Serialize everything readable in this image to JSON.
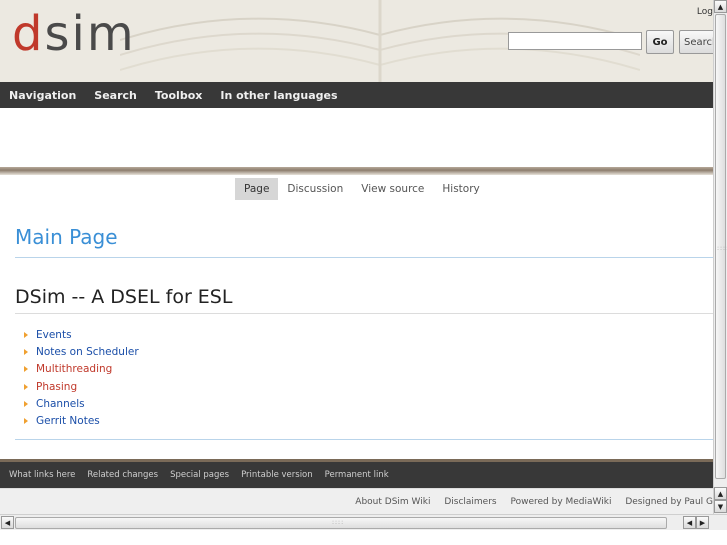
{
  "header": {
    "logo_prefix": "d",
    "logo_suffix": "sim",
    "login_link": "Log",
    "search": {
      "value": "",
      "placeholder": ""
    },
    "go_label": "Go",
    "search_label": "Search"
  },
  "nav": [
    "Navigation",
    "Search",
    "Toolbox",
    "In other languages"
  ],
  "tabs": [
    {
      "label": "Page",
      "active": true
    },
    {
      "label": "Discussion"
    },
    {
      "label": "View source"
    },
    {
      "label": "History"
    }
  ],
  "content": {
    "page_title": "Main Page",
    "section_title": "DSim -- A DSEL for ESL",
    "links": [
      {
        "label": "Events",
        "state": "blue"
      },
      {
        "label": "Notes on Scheduler",
        "state": "blue"
      },
      {
        "label": "Multithreading",
        "state": "red"
      },
      {
        "label": "Phasing",
        "state": "red"
      },
      {
        "label": "Channels",
        "state": "blue"
      },
      {
        "label": "Gerrit Notes",
        "state": "blue"
      }
    ]
  },
  "footer": {
    "toolbox_links": [
      "What links here",
      "Related changes",
      "Special pages",
      "Printable version",
      "Permanent link"
    ],
    "info_links": [
      "About DSim Wiki",
      "Disclaimers",
      "Powered by MediaWiki",
      "Designed by Paul G"
    ]
  },
  "colors": {
    "brand_red": "#c0392b",
    "nav_bg": "#383838",
    "link_blue": "#1a4ea8",
    "title_blue": "#3a8fd6",
    "bullet_orange": "#f0a030"
  }
}
